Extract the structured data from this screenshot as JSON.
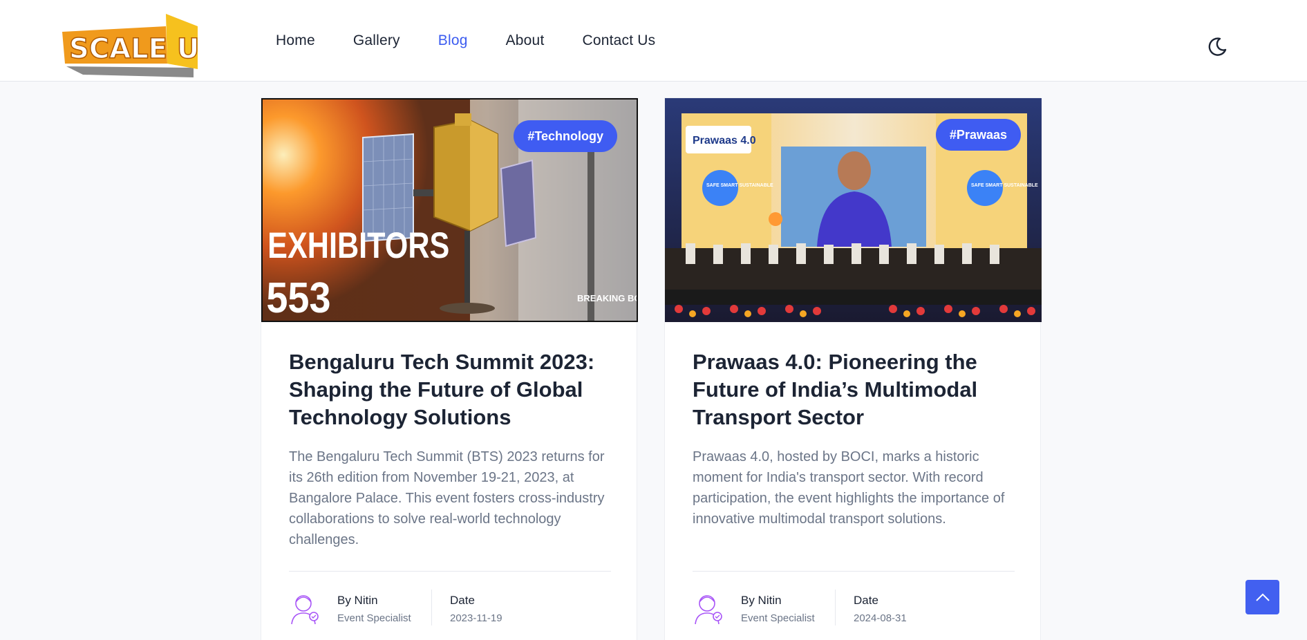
{
  "colors": {
    "accent": "#3f5cf2",
    "text": "#1c2434",
    "muted": "#6b7587",
    "logo_orange": "#f09a1c",
    "logo_yellow": "#f6c11e"
  },
  "logo": {
    "text": "SCALE UP"
  },
  "nav": {
    "items": [
      {
        "label": "Home",
        "active": false
      },
      {
        "label": "Gallery",
        "active": false
      },
      {
        "label": "Blog",
        "active": true
      },
      {
        "label": "About",
        "active": false
      },
      {
        "label": "Contact Us",
        "active": false
      }
    ]
  },
  "theme_toggle": {
    "icon": "moon-icon"
  },
  "posts": [
    {
      "tag": "#Technology",
      "image": {
        "overlay_big": "EXHIBITORS",
        "overlay_num": "553",
        "overlay_small": "BREAKING BOUNDARIES"
      },
      "title": "Bengaluru Tech Summit 2023: Shaping the Future of Global Technology Solutions",
      "description": "The Bengaluru Tech Summit (BTS) 2023 returns for its 26th edition from November 19-21, 2023, at Bangalore Palace. This event fosters cross-industry collaborations to solve real-world technology challenges.",
      "author": "By Nitin",
      "role": "Event Specialist",
      "date_label": "Date",
      "date": "2023-11-19"
    },
    {
      "tag": "#Prawaas",
      "image": {
        "banner_text": "Prawaas 4.0",
        "sign_text": "SAFE SMART SUSTAINABLE"
      },
      "title": "Prawaas 4.0: Pioneering the Future of India’s Multimodal Transport Sector",
      "description": "Prawaas 4.0, hosted by BOCI, marks a historic moment for India's transport sector. With record participation, the event highlights the importance of innovative multimodal transport solutions.",
      "author": "By Nitin",
      "role": "Event Specialist",
      "date_label": "Date",
      "date": "2024-08-31"
    }
  ],
  "scroll_top": {
    "icon": "chevron-up-icon"
  }
}
